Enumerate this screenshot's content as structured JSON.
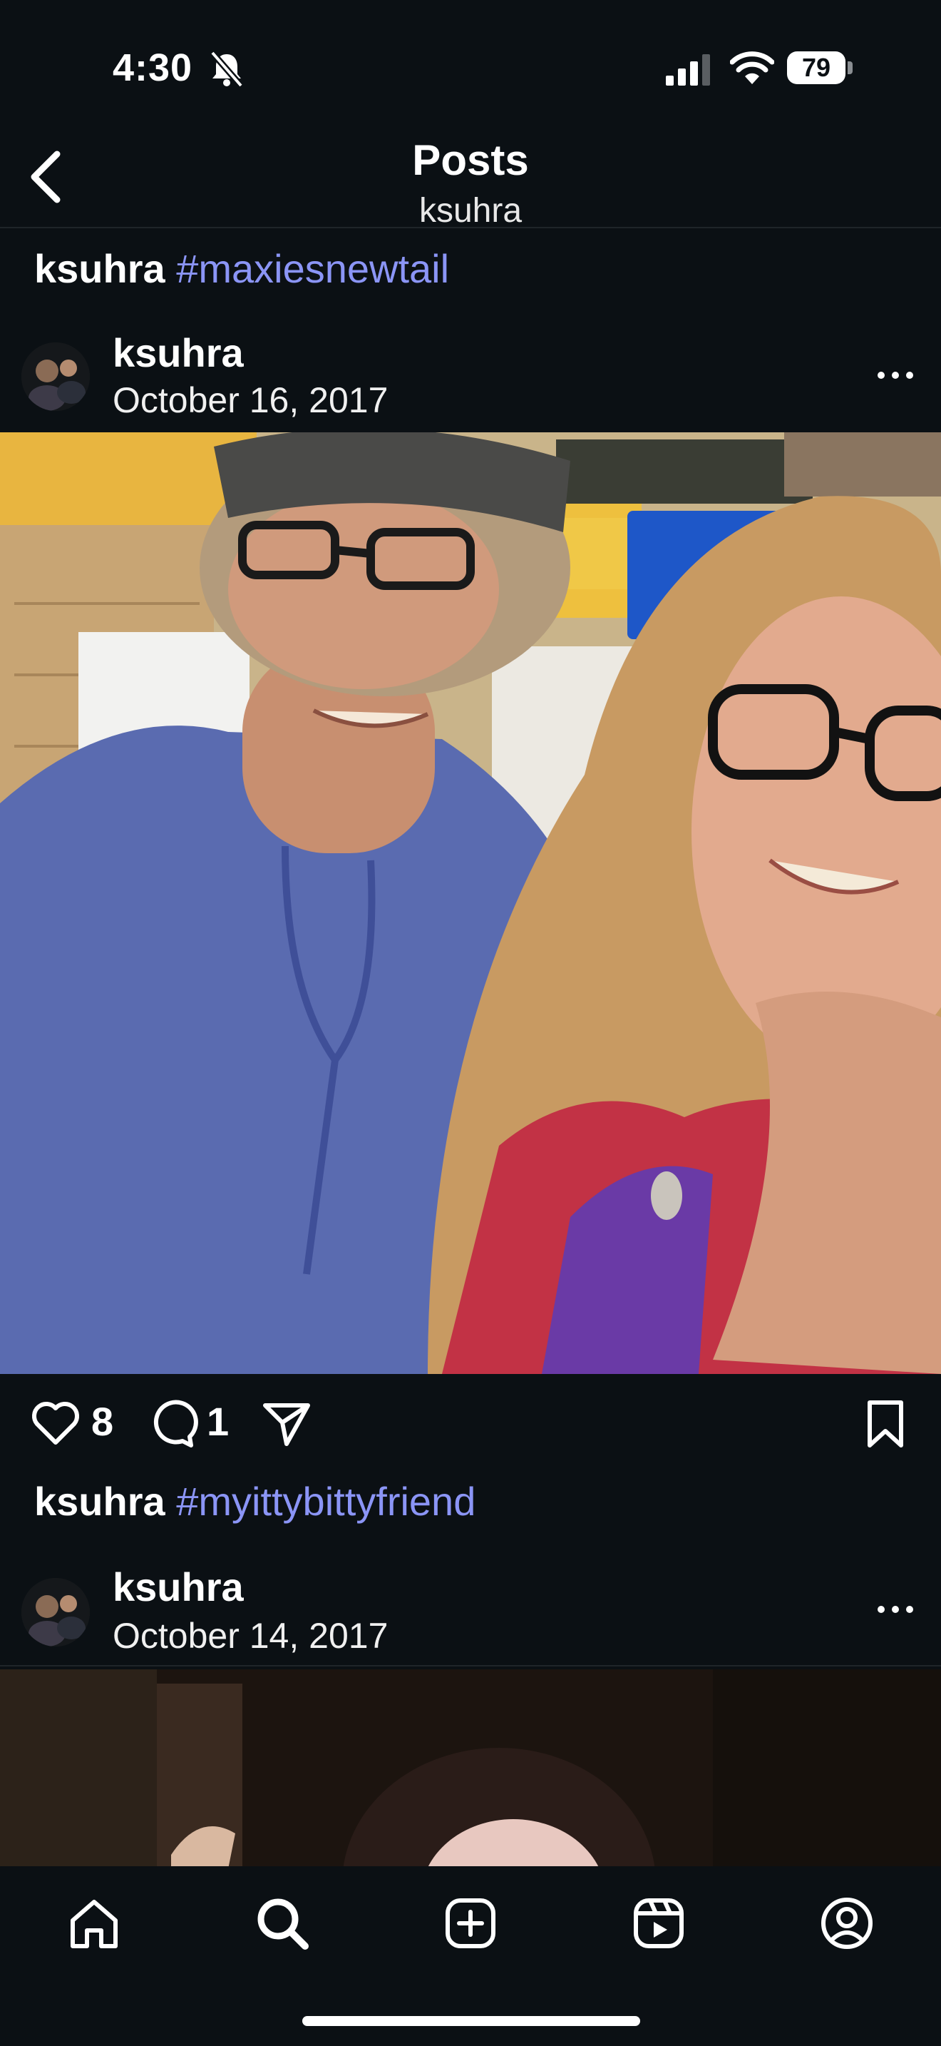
{
  "status_bar": {
    "time": "4:30",
    "battery": "79"
  },
  "nav": {
    "title": "Posts",
    "subtitle": "ksuhra"
  },
  "posts": [
    {
      "caption_user": "ksuhra",
      "caption_tag": "#maxiesnewtail",
      "username": "ksuhra",
      "date": "October 16, 2017"
    },
    {
      "caption_user": "ksuhra",
      "caption_tag": "#myittybittyfriend",
      "username": "ksuhra",
      "date": "October 14, 2017"
    }
  ],
  "actions": {
    "likes": "8",
    "comments": "1"
  },
  "colors": {
    "background": "#0b1014",
    "hashtag": "#8b95f6",
    "text": "#ffffff"
  },
  "icons": [
    "back-chevron-icon",
    "bell-off-icon",
    "signal-icon",
    "wifi-icon",
    "battery-icon",
    "heart-icon",
    "comment-icon",
    "share-icon",
    "bookmark-icon",
    "more-icon",
    "home-icon",
    "search-icon",
    "create-icon",
    "reels-icon",
    "profile-icon"
  ]
}
